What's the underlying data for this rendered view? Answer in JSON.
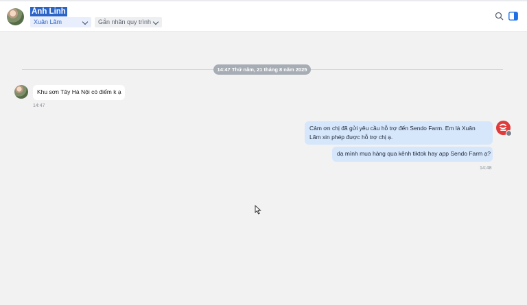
{
  "header": {
    "contact_name": "Ánh Linh",
    "assignee": "Xuân Lãm",
    "tag_button": "Gắn nhãn quy trình"
  },
  "conversation": {
    "date_separator": "14:47 Thứ năm, 21 tháng 8 năm 2025",
    "incoming": [
      {
        "text": "Khu sơn Tây Hà Nội có điểm k ạ",
        "time": "14:47"
      }
    ],
    "outgoing": [
      {
        "text": "Cảm ơn chị đã gửi yêu cầu hỗ trợ đến Sendo Farm. Em là Xuân Lãm xin phép được hỗ trợ chị ạ."
      },
      {
        "text": "dạ mình mua hàng qua kênh tiktok hay app Sendo Farm ạ?"
      }
    ],
    "outgoing_time": "14:48"
  },
  "colors": {
    "accent": "#2b64c9",
    "outgoing_bubble": "#d6e6fb",
    "agent_avatar": "#e03b3b"
  },
  "icons": {
    "search": "search-icon",
    "panel": "side-panel-icon",
    "agent": "sendo-logo-icon"
  }
}
